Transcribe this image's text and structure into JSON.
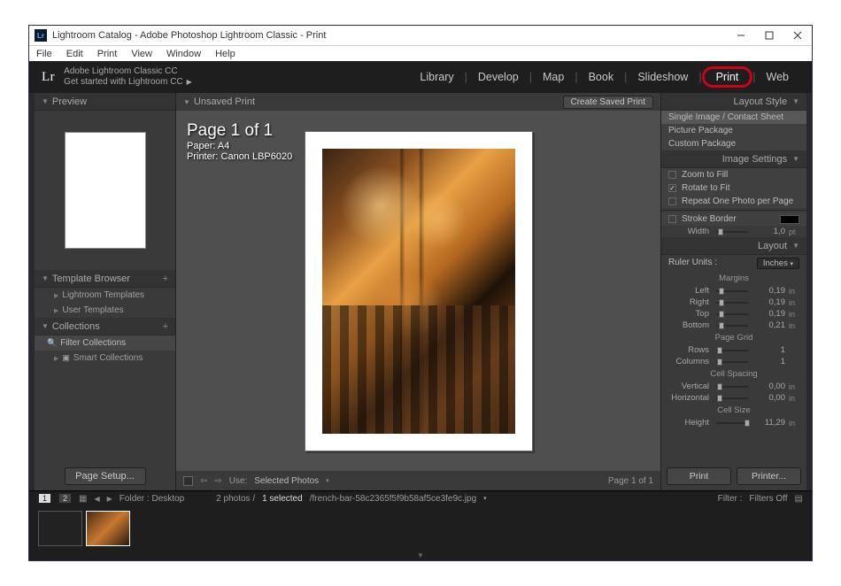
{
  "window": {
    "title": "Lightroom Catalog - Adobe Photoshop Lightroom Classic - Print"
  },
  "menu": [
    "File",
    "Edit",
    "Print",
    "View",
    "Window",
    "Help"
  ],
  "header": {
    "logo": "Lr",
    "product": "Adobe Lightroom Classic CC",
    "tagline": "Get started with Lightroom CC",
    "modules": [
      "Library",
      "Develop",
      "Map",
      "Book",
      "Slideshow",
      "Print",
      "Web"
    ],
    "active_module": "Print"
  },
  "left": {
    "preview_title": "Preview",
    "template_browser": "Template Browser",
    "templates": [
      "Lightroom Templates",
      "User Templates"
    ],
    "collections": "Collections",
    "filter_collections": "Filter Collections",
    "smart_collections": "Smart Collections",
    "page_setup": "Page Setup..."
  },
  "center": {
    "unsaved": "Unsaved Print",
    "create": "Create Saved Print",
    "page_of": "Page 1 of 1",
    "paper": "Paper:  A4",
    "printer": "Printer:  Canon LBP6020",
    "use_label": "Use:",
    "use_value": "Selected Photos",
    "footer_page": "Page 1 of 1"
  },
  "right": {
    "layout_style": "Layout Style",
    "style_opts": [
      "Single Image / Contact Sheet",
      "Picture Package",
      "Custom Package"
    ],
    "image_settings": "Image Settings",
    "zoom": "Zoom to Fill",
    "rotate": "Rotate to Fit",
    "repeat": "Repeat One Photo per Page",
    "stroke": "Stroke Border",
    "width": "Width",
    "width_val": "1,0",
    "width_un": "pt",
    "layout": "Layout",
    "ruler_units": "Ruler Units :",
    "ruler_val": "Inches",
    "margins": "Margins",
    "margin_rows": [
      {
        "lbl": "Left",
        "val": "0,19",
        "un": "in",
        "pos": 8
      },
      {
        "lbl": "Right",
        "val": "0,19",
        "un": "in",
        "pos": 8
      },
      {
        "lbl": "Top",
        "val": "0,19",
        "un": "in",
        "pos": 8
      },
      {
        "lbl": "Bottom",
        "val": "0,21",
        "un": "in",
        "pos": 9
      }
    ],
    "page_grid": "Page Grid",
    "grid_rows": [
      {
        "lbl": "Rows",
        "val": "1",
        "un": "",
        "pos": 4
      },
      {
        "lbl": "Columns",
        "val": "1",
        "un": "",
        "pos": 4
      }
    ],
    "cell_spacing": "Cell Spacing",
    "spacing_rows": [
      {
        "lbl": "Vertical",
        "val": "0,00",
        "un": "in",
        "pos": 4
      },
      {
        "lbl": "Horizontal",
        "val": "0,00",
        "un": "in",
        "pos": 4
      }
    ],
    "cell_size": "Cell Size",
    "size_rows": [
      {
        "lbl": "Height",
        "val": "11,29",
        "un": "in",
        "pos": 90
      }
    ],
    "print_btn": "Print",
    "printer_btn": "Printer..."
  },
  "status": {
    "folder": "Folder : Desktop",
    "count": "2 photos /",
    "selected": "1 selected",
    "filename": "/french-bar-58c2365f5f9b58af5ce3fe9c.jpg",
    "filter_label": "Filter :",
    "filter_val": "Filters Off"
  }
}
